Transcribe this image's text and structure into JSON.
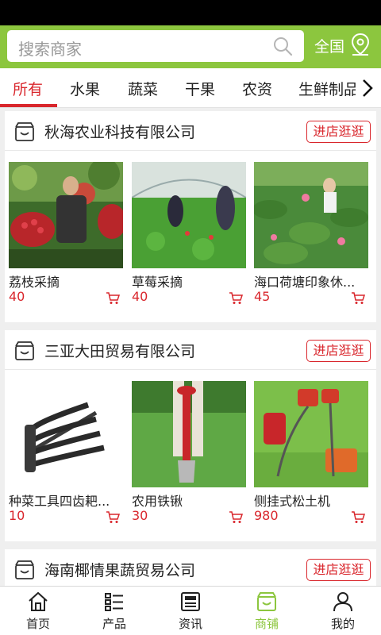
{
  "search": {
    "placeholder": "搜索商家",
    "region": "全国"
  },
  "tabs": [
    "所有",
    "水果",
    "蔬菜",
    "干果",
    "农资",
    "生鲜制品"
  ],
  "active_tab": 0,
  "colors": {
    "brand": "#8cc63e",
    "accent": "#d9262c"
  },
  "shops": [
    {
      "name": "秋海农业科技有限公司",
      "button": "进店逛逛",
      "products": [
        {
          "name": "荔枝采摘",
          "price": "40"
        },
        {
          "name": "草莓采摘",
          "price": "40"
        },
        {
          "name": "海口荷塘印象休...",
          "price": "45"
        }
      ]
    },
    {
      "name": "三亚大田贸易有限公司",
      "button": "进店逛逛",
      "products": [
        {
          "name": "种菜工具四齿耙...",
          "price": "10"
        },
        {
          "name": "农用铁锹",
          "price": "30"
        },
        {
          "name": "侧挂式松土机",
          "price": "980"
        }
      ]
    },
    {
      "name": "海南椰情果蔬贸易公司",
      "button": "进店逛逛",
      "products": []
    }
  ],
  "nav": [
    {
      "label": "首页",
      "icon": "home-icon"
    },
    {
      "label": "产品",
      "icon": "list-icon"
    },
    {
      "label": "资讯",
      "icon": "news-icon"
    },
    {
      "label": "商铺",
      "icon": "shop-icon"
    },
    {
      "label": "我的",
      "icon": "user-icon"
    }
  ],
  "active_nav": 3
}
